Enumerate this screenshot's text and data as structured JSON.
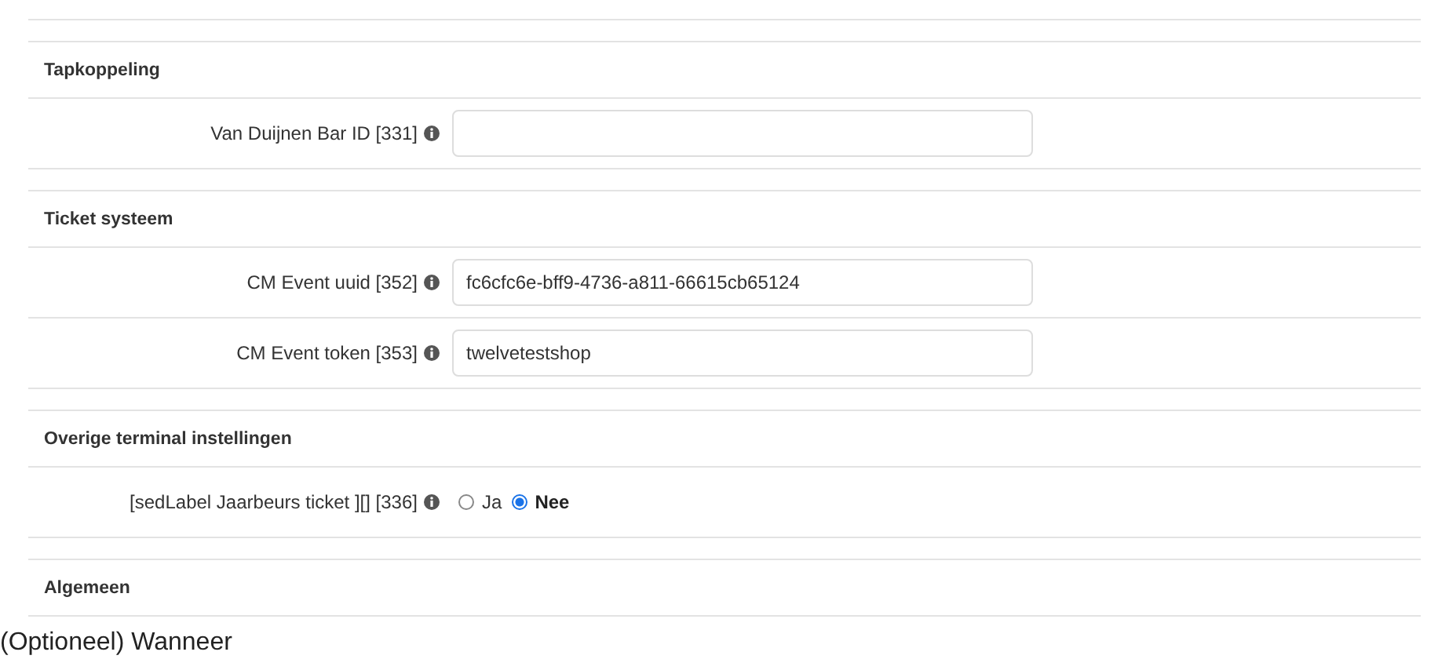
{
  "sections": [
    {
      "title": "Tapkoppeling",
      "fields": [
        {
          "kind": "text",
          "label": "Van Duijnen Bar ID [331]"
        }
      ]
    },
    {
      "title": "Ticket systeem",
      "fields": [
        {
          "kind": "text",
          "label": "CM Event uuid [352]",
          "value": "fc6cfc6e-bff9-4736-a811-66615cb65124"
        },
        {
          "kind": "text",
          "label": "CM Event token [353]",
          "value": "twelvetestshop"
        }
      ]
    },
    {
      "title": "Overige terminal instellingen",
      "fields": [
        {
          "kind": "radio",
          "label": "[sedLabel Jaarbeurs ticket ][] [336]",
          "options": [
            {
              "label": "Ja",
              "selected": false
            },
            {
              "label": "Nee",
              "selected": true
            }
          ]
        }
      ]
    },
    {
      "title": "Algemeen"
    }
  ],
  "footer_text": "(Optioneel) Wanneer"
}
